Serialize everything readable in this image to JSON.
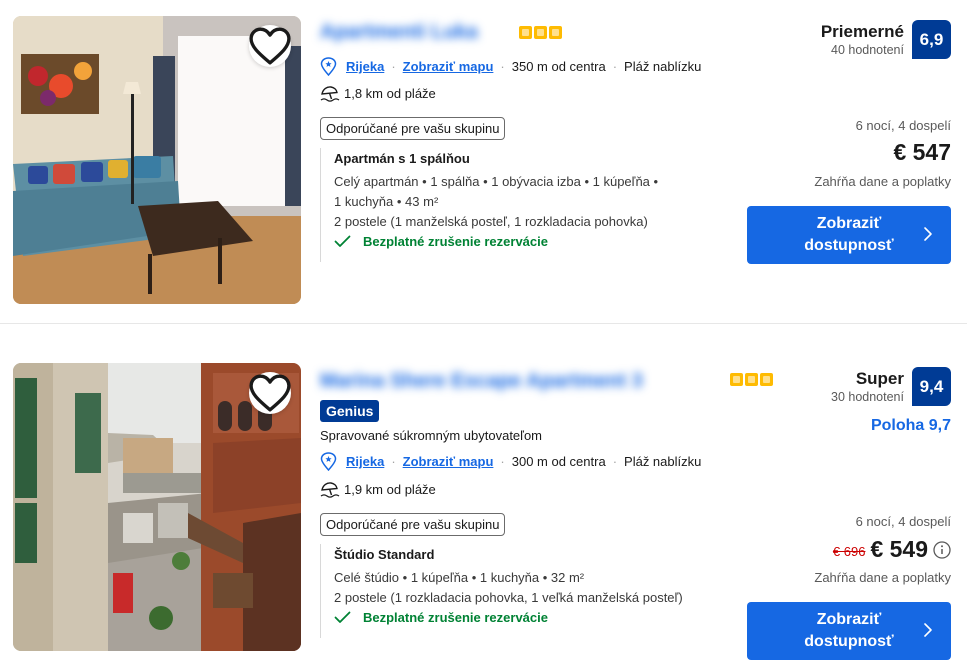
{
  "listings": [
    {
      "title": "Apartmenti Luka",
      "stars": 3,
      "location": {
        "city": "Rijeka",
        "map_link": "Zobraziť mapu",
        "distance": "350 m od centra",
        "beach_note": "Pláž nablízku"
      },
      "beach_distance": "1,8 km od pláže",
      "recommend_badge": "Odporúčané pre vašu skupinu",
      "unit": {
        "name": "Apartmán s 1 spálňou",
        "line1": "Celý apartmán • 1 spálňa • 1 obývacia izba • 1 kúpeľňa •",
        "line2": "1 kuchyňa • 43 m²",
        "beds": "2 postele (1 manželská posteľ, 1 rozkladacia pohovka)",
        "cancellation": "Bezplatné zrušenie rezervácie"
      },
      "review": {
        "word": "Priemerné",
        "count": "40 hodnotení",
        "score": "6,9"
      },
      "stay": "6 nocí, 4 dospelí",
      "price": "€ 547",
      "taxes": "Zahŕňa dane a poplatky",
      "cta": "Zobraziť dostupnosť"
    },
    {
      "title": "Marina Shere Escape Apartment 3",
      "stars": 3,
      "genius": "Genius",
      "managed": "Spravované súkromným ubytovateľom",
      "location": {
        "city": "Rijeka",
        "map_link": "Zobraziť mapu",
        "distance": "300 m od centra",
        "beach_note": "Pláž nablízku"
      },
      "beach_distance": "1,9 km od pláže",
      "recommend_badge": "Odporúčané pre vašu skupinu",
      "unit": {
        "name": "Štúdio Standard",
        "line1": "Celé štúdio • 1 kúpeľňa • 1 kuchyňa • 32 m²",
        "beds": "2 postele (1 rozkladacia pohovka, 1 veľká manželská posteľ)",
        "cancellation": "Bezplatné zrušenie rezervácie"
      },
      "review": {
        "word": "Super",
        "count": "30 hodnotení",
        "score": "9,4"
      },
      "location_score": "Poloha 9,7",
      "stay": "6 nocí, 4 dospelí",
      "old_price": "€ 696",
      "price": "€ 549",
      "taxes": "Zahŕňa dane a poplatky",
      "cta": "Zobraziť dostupnosť"
    }
  ],
  "colors": {
    "brand_blue": "#003b95",
    "link_blue": "#1668e3",
    "star_yellow": "#febb02",
    "green": "#008234",
    "strike_red": "#cc0000"
  },
  "icons": [
    "heart-icon",
    "location-pin-icon",
    "beach-umbrella-icon",
    "checkmark-icon",
    "chevron-right-icon",
    "info-icon",
    "star-icon"
  ]
}
